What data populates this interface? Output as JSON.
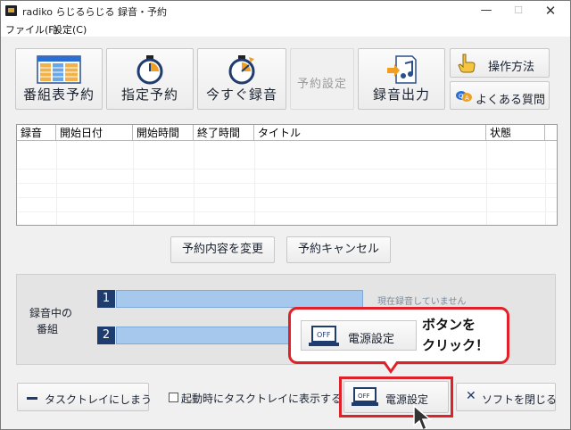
{
  "window": {
    "title": "radiko らじるらじる 録音・予約",
    "minimize_glyph": "—",
    "maximize_glyph": "☐",
    "close_glyph": "✕"
  },
  "menu": [
    "ファイル(F)",
    "設定(C)"
  ],
  "toolbar": {
    "program_guide_label": "番組表予約",
    "scheduled_label": "指定予約",
    "record_now_label": "今すぐ録音",
    "reservation_settings_label": "予約設定",
    "export_label": "録音出力",
    "how_to_label": "操作方法",
    "faq_label": "よくある質問"
  },
  "list": {
    "columns": [
      "録音",
      "開始日付",
      "開始時間",
      "終了時間",
      "タイトル",
      "状態"
    ],
    "rows": []
  },
  "actions": {
    "change_label": "予約内容を変更",
    "cancel_label": "予約キャンセル"
  },
  "recording": {
    "caption": "録音中の\n番組",
    "slots": [
      {
        "number": "1",
        "status": "現在録音していません"
      },
      {
        "number": "2",
        "status": ""
      }
    ]
  },
  "callout": {
    "button_label": "電源設定",
    "button_icon_text": "OFF",
    "text_line1": "ボタンを",
    "text_line2": "クリック！"
  },
  "bottom": {
    "tray_label": "タスクトレイにしまう",
    "startup_checkbox_label": "起動時にタスクトレイに表示する",
    "startup_checked": false,
    "power_label": "電源設定",
    "power_icon_text": "OFF",
    "close_label": "ソフトを閉じる"
  },
  "colors": {
    "accent_red": "#e0212a",
    "navy": "#1f3c6e",
    "bar_blue": "#a6c8ec"
  }
}
